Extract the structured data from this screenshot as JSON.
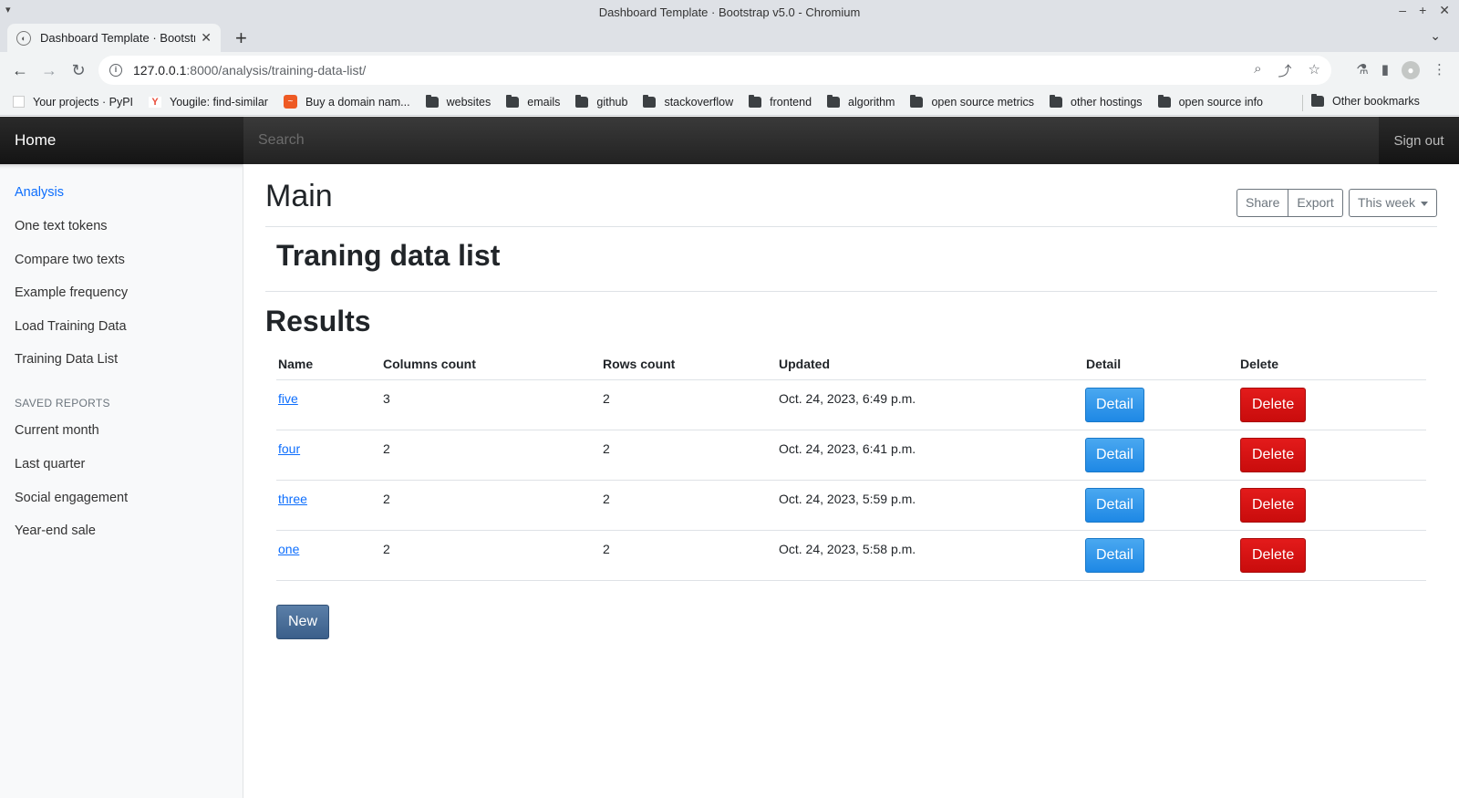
{
  "window": {
    "title": "Dashboard Template · Bootstrap v5.0 - Chromium"
  },
  "tab": {
    "title": "Dashboard Template · Bootstrap v5.0"
  },
  "address": {
    "host": "127.0.0.1",
    "path": ":8000/analysis/training-data-list/"
  },
  "bookmarks": [
    {
      "label": "Your projects · PyPI",
      "icon": "pypi"
    },
    {
      "label": "Yougile: find-similar",
      "icon": "yougile"
    },
    {
      "label": "Buy a domain nam...",
      "icon": "domain"
    },
    {
      "label": "websites",
      "icon": "folder"
    },
    {
      "label": "emails",
      "icon": "folder"
    },
    {
      "label": "github",
      "icon": "folder"
    },
    {
      "label": "stackoverflow",
      "icon": "folder"
    },
    {
      "label": "frontend",
      "icon": "folder"
    },
    {
      "label": "algorithm",
      "icon": "folder"
    },
    {
      "label": "open source metrics",
      "icon": "folder"
    },
    {
      "label": "other hostings",
      "icon": "folder"
    },
    {
      "label": "open source info",
      "icon": "folder"
    }
  ],
  "other_bookmarks": "Other bookmarks",
  "navbar": {
    "brand": "Home",
    "search_placeholder": "Search",
    "signout": "Sign out"
  },
  "sidebar": {
    "items": [
      {
        "label": "Analysis",
        "active": true
      },
      {
        "label": "One text tokens"
      },
      {
        "label": "Compare two texts"
      },
      {
        "label": "Example frequency"
      },
      {
        "label": "Load Training Data"
      },
      {
        "label": "Training Data List"
      }
    ],
    "saved_heading": "SAVED REPORTS",
    "saved": [
      {
        "label": "Current month"
      },
      {
        "label": "Last quarter"
      },
      {
        "label": "Social engagement"
      },
      {
        "label": "Year-end sale"
      }
    ]
  },
  "main": {
    "title": "Main",
    "share": "Share",
    "export": "Export",
    "period": "This week",
    "section_title": "Traning data list",
    "results_title": "Results",
    "columns": [
      "Name",
      "Columns count",
      "Rows count",
      "Updated",
      "Detail",
      "Delete"
    ],
    "rows": [
      {
        "name": "five",
        "columns": "3",
        "rows": "2",
        "updated": "Oct. 24, 2023, 6:49 p.m."
      },
      {
        "name": "four",
        "columns": "2",
        "rows": "2",
        "updated": "Oct. 24, 2023, 6:41 p.m."
      },
      {
        "name": "three",
        "columns": "2",
        "rows": "2",
        "updated": "Oct. 24, 2023, 5:59 p.m."
      },
      {
        "name": "one",
        "columns": "2",
        "rows": "2",
        "updated": "Oct. 24, 2023, 5:58 p.m."
      }
    ],
    "detail_label": "Detail",
    "delete_label": "Delete",
    "new_label": "New"
  }
}
